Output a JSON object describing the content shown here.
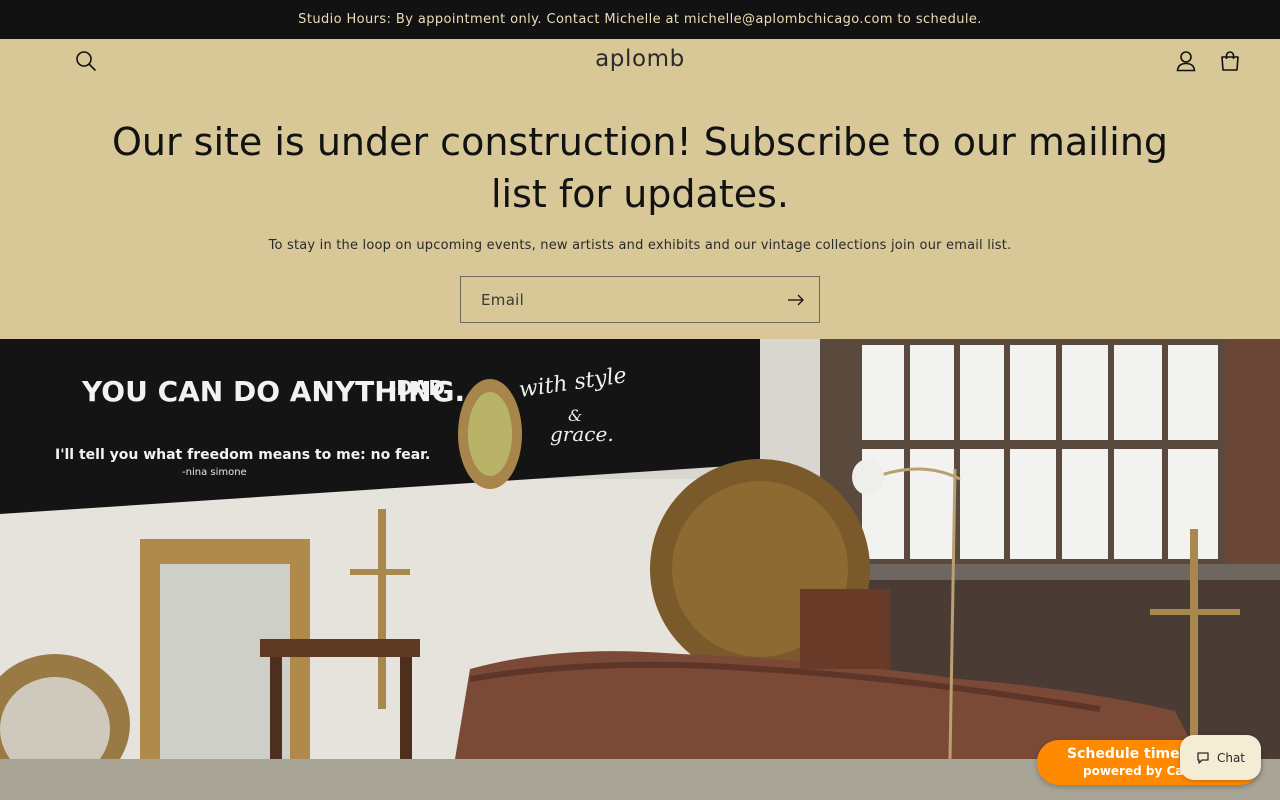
{
  "announcement": {
    "text": "Studio Hours: By appointment only. Contact Michelle at michelle@aplombchicago.com to schedule."
  },
  "header": {
    "logo": "aplomb",
    "search_icon": "search-icon",
    "account_icon": "account-icon",
    "cart_icon": "cart-icon"
  },
  "newsletter": {
    "headline": "Our site is under construction! Subscribe to our mailing list for updates.",
    "subtext": "To stay in the loop on upcoming events, new artists and exhibits and our vintage collections join our email list.",
    "email_placeholder": "Email",
    "submit_icon": "arrow-right-icon"
  },
  "hero": {
    "chalk_line_1": "YOU CAN DO ANYTHING.",
    "chalk_line_1_attr": "-DAD",
    "chalk_line_2": "I'll tell you what freedom means to me: no fear.",
    "chalk_line_2_attr": "-nina simone",
    "chalk_line_3a": "with style",
    "chalk_line_3b": "&",
    "chalk_line_3c": "grace."
  },
  "widgets": {
    "scheduler_line1": "Schedule time w",
    "scheduler_line2": "powered by Cal",
    "chat_label": "Chat",
    "chat_icon": "chat-bubble-icon"
  },
  "colors": {
    "announcement_bg": "#121212",
    "accent": "#d8c797",
    "scheduler": "#ff8a00"
  }
}
